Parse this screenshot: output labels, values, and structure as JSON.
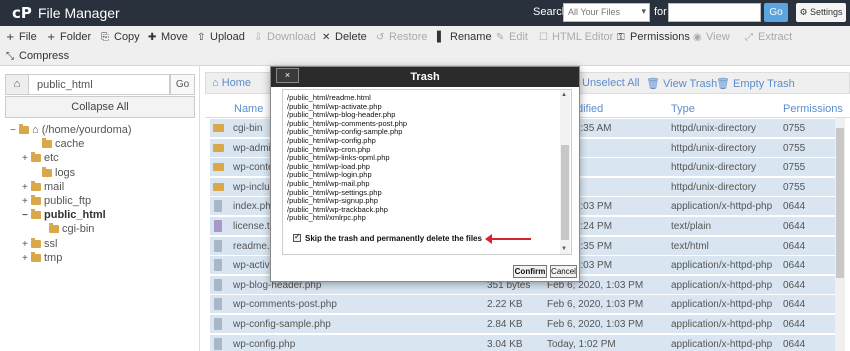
{
  "header": {
    "title": "File Manager",
    "logo": "cP",
    "search_label": "Search",
    "search_scope": "All Your Files",
    "for_label": "for",
    "go_label": "Go",
    "settings_label": "Settings"
  },
  "toolbar": {
    "row1": [
      {
        "icon": "plus-icon",
        "glyph": "+",
        "label": "File",
        "disabled": false
      },
      {
        "icon": "plus-icon",
        "glyph": "+",
        "label": "Folder",
        "disabled": false
      },
      {
        "icon": "copy-icon",
        "glyph": "⎘",
        "label": "Copy",
        "disabled": false
      },
      {
        "icon": "move-icon",
        "glyph": "✚",
        "label": "Move",
        "disabled": false
      },
      {
        "icon": "upload-icon",
        "glyph": "⇧",
        "label": "Upload",
        "disabled": false
      },
      {
        "icon": "download-icon",
        "glyph": "⇩",
        "label": "Download",
        "disabled": true
      },
      {
        "icon": "delete-icon",
        "glyph": "✕",
        "label": "Delete",
        "disabled": false
      },
      {
        "icon": "restore-icon",
        "glyph": "↺",
        "label": "Restore",
        "disabled": true
      },
      {
        "icon": "rename-icon",
        "glyph": "▌",
        "label": "Rename",
        "disabled": false
      },
      {
        "icon": "edit-icon",
        "glyph": "✎",
        "label": "Edit",
        "disabled": true
      },
      {
        "icon": "html-editor-icon",
        "glyph": "☐",
        "label": "HTML Editor",
        "disabled": true
      },
      {
        "icon": "key-icon",
        "glyph": "⚿",
        "label": "Permissions",
        "disabled": false
      },
      {
        "icon": "eye-icon",
        "glyph": "◉",
        "label": "View",
        "disabled": true
      },
      {
        "icon": "extract-icon",
        "glyph": "⤢",
        "label": "Extract",
        "disabled": true
      }
    ],
    "row2": [
      {
        "icon": "compress-icon",
        "glyph": "⤡",
        "label": "Compress",
        "disabled": false
      }
    ]
  },
  "left": {
    "path_value": "public_html",
    "go_label": "Go",
    "collapse_label": "Collapse All",
    "tree": [
      {
        "toggle": "−",
        "label": "(/home/yourdoma)",
        "home": true,
        "bold": false
      },
      {
        "toggle": "",
        "label": "cache",
        "bold": false
      },
      {
        "toggle": "+",
        "label": "etc",
        "bold": false
      },
      {
        "toggle": "",
        "label": "logs",
        "bold": false
      },
      {
        "toggle": "+",
        "label": "mail",
        "bold": false
      },
      {
        "toggle": "+",
        "label": "public_ftp",
        "bold": false
      },
      {
        "toggle": "−",
        "label": "public_html",
        "bold": true
      },
      {
        "toggle": "",
        "label": "cgi-bin",
        "bold": false
      },
      {
        "toggle": "+",
        "label": "ssl",
        "bold": false
      },
      {
        "toggle": "+",
        "label": "tmp",
        "bold": false
      }
    ]
  },
  "right": {
    "bar": {
      "home_label": "Home",
      "unselect_label": "Unselect All",
      "view_trash_label": "View Trash",
      "empty_trash_label": "Empty Trash"
    },
    "columns": {
      "name": "Name",
      "modified": "dified",
      "type": "Type",
      "permissions": "Permissions"
    },
    "rows": [
      {
        "name": "cgi-bin",
        "size": "",
        "modified": "2017, 9:35 AM",
        "type": "httpd/unix-directory",
        "perms": "0755",
        "kind": "dir"
      },
      {
        "name": "wp-admi",
        "size": "",
        "modified": "02 PM",
        "type": "httpd/unix-directory",
        "perms": "0755",
        "kind": "dir"
      },
      {
        "name": "wp-conte",
        "size": "",
        "modified": "02 PM",
        "type": "httpd/unix-directory",
        "perms": "0755",
        "kind": "dir"
      },
      {
        "name": "wp-incluc",
        "size": "",
        "modified": "02 PM",
        "type": "httpd/unix-directory",
        "perms": "0755",
        "kind": "dir"
      },
      {
        "name": "index.php",
        "size": "",
        "modified": "2020, 1:03 PM",
        "type": "application/x-httpd-php",
        "perms": "0644",
        "kind": "file"
      },
      {
        "name": "license.tx",
        "size": "",
        "modified": "2020, 6:24 PM",
        "type": "text/plain",
        "perms": "0644",
        "kind": "txt"
      },
      {
        "name": "readme.h",
        "size": "",
        "modified": "2020, 8:35 PM",
        "type": "text/html",
        "perms": "0644",
        "kind": "file"
      },
      {
        "name": "wp-activa",
        "size": "",
        "modified": "2020, 1:03 PM",
        "type": "application/x-httpd-php",
        "perms": "0644",
        "kind": "file"
      },
      {
        "name": "wp-blog-header.php",
        "size": "351 bytes",
        "modified": "Feb 6, 2020, 1:03 PM",
        "type": "application/x-httpd-php",
        "perms": "0644",
        "kind": "file"
      },
      {
        "name": "wp-comments-post.php",
        "size": "2.22 KB",
        "modified": "Feb 6, 2020, 1:03 PM",
        "type": "application/x-httpd-php",
        "perms": "0644",
        "kind": "file"
      },
      {
        "name": "wp-config-sample.php",
        "size": "2.84 KB",
        "modified": "Feb 6, 2020, 1:03 PM",
        "type": "application/x-httpd-php",
        "perms": "0644",
        "kind": "file"
      },
      {
        "name": "wp-config.php",
        "size": "3.04 KB",
        "modified": "Today, 1:02 PM",
        "type": "application/x-httpd-php",
        "perms": "0644",
        "kind": "file"
      }
    ]
  },
  "dialog": {
    "title": "Trash",
    "close_label": "×",
    "files": [
      "/public_html/readme.html",
      "/public_html/wp-activate.php",
      "/public_html/wp-blog-header.php",
      "/public_html/wp-comments-post.php",
      "/public_html/wp-config-sample.php",
      "/public_html/wp-config.php",
      "/public_html/wp-cron.php",
      "/public_html/wp-links-opml.php",
      "/public_html/wp-load.php",
      "/public_html/wp-login.php",
      "/public_html/wp-mail.php",
      "/public_html/wp-settings.php",
      "/public_html/wp-signup.php",
      "/public_html/wp-trackback.php",
      "/public_html/xmlrpc.php"
    ],
    "skip_label": "Skip the trash and permanently delete the files",
    "skip_checked": true,
    "confirm_label": "Confirm",
    "cancel_label": "Cancel"
  }
}
